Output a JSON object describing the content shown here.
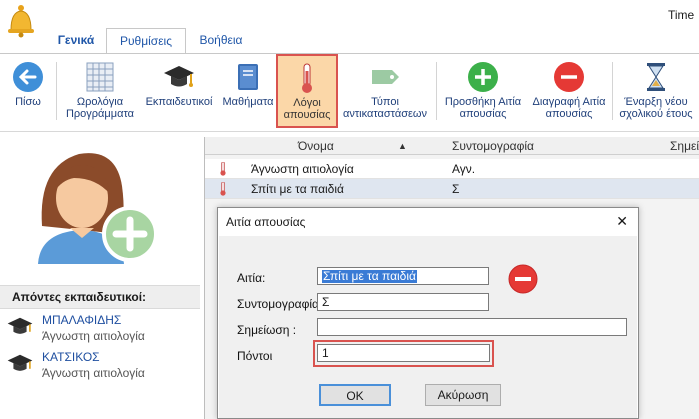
{
  "window": {
    "title": "Time"
  },
  "tabs": [
    {
      "label": "Γενικά"
    },
    {
      "label": "Ρυθμίσεις"
    },
    {
      "label": "Βοήθεια"
    }
  ],
  "toolbar": {
    "back": "Πίσω",
    "timetables": "Ωρολόγια\nΠρογράμματα",
    "teachers": "Εκπαιδευτικοί",
    "subjects": "Μαθήματα",
    "absence_reasons": "Λόγοι\nαπουσίας",
    "substitution_types": "Τύποι\nαντικαταστάσεων",
    "add_reason": "Προσθήκη Αιτία\nαπουσίας",
    "delete_reason": "Διαγραφή Αιτία\nαπουσίας",
    "start_year": "Έναρξη νέου\nσχολικού έτους"
  },
  "left_panel": {
    "absent_header": "Απόντες εκπαιδευτικοί:",
    "absent": [
      {
        "name": "ΜΠΑΛΑΦΙΔΗΣ",
        "reason": "Άγνωστη αιτιολογία"
      },
      {
        "name": "ΚΑΤΣΙΚΟΣ",
        "reason": "Άγνωστη αιτιολογία"
      }
    ]
  },
  "grid": {
    "columns": [
      "Όνομα",
      "Συντομογραφία",
      "Σημείω"
    ],
    "rows": [
      {
        "name": "Άγνωστη αιτιολογία",
        "abbr": "Αγν."
      },
      {
        "name": "Σπίτι με τα παιδιά",
        "abbr": "Σ"
      }
    ]
  },
  "dialog": {
    "title": "Αιτία απουσίας",
    "close": "✕",
    "reason_label": "Αιτία:",
    "reason_value": "Σπίτι με τα παιδιά",
    "abbr_label": "Συντομογραφία",
    "abbr_value": "Σ",
    "note_label": "Σημείωση :",
    "note_value": "",
    "points_label": "Πόντοι",
    "points_value": "1",
    "ok": "OK",
    "cancel": "Ακύρωση"
  },
  "colors": {
    "accent_red": "#d9534f",
    "add_green": "#3cb04a",
    "delete_red": "#e53935",
    "link_blue": "#1f4fa0"
  }
}
